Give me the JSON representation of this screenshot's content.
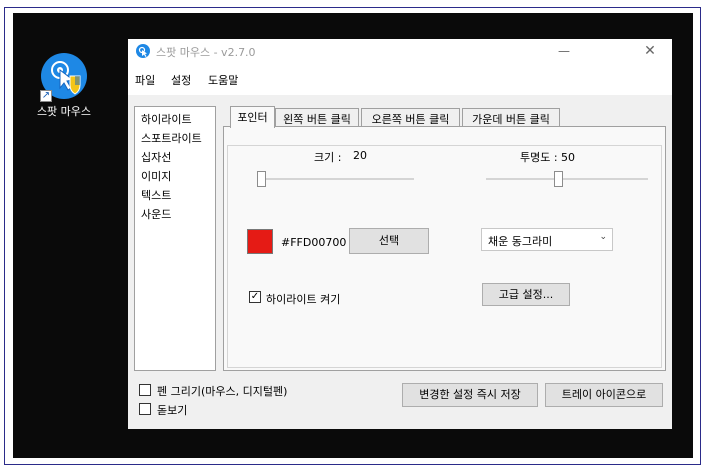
{
  "desktop_icon": {
    "label": "스팟 마우스",
    "icon": "spot-mouse-app-icon"
  },
  "window": {
    "title": "스팟 마우스 - v2.7.0",
    "minimize": "—",
    "close": "✕"
  },
  "menu": {
    "items": [
      "파일",
      "설정",
      "도움말"
    ]
  },
  "sidebar": {
    "items": [
      "하이라이트",
      "스포트라이트",
      "십자선",
      "이미지",
      "텍스트",
      "사운드"
    ]
  },
  "tabs": [
    "포인터",
    "왼쪽 버튼 클릭",
    "오른쪽 버튼 클릭",
    "가운데 버튼 클릭"
  ],
  "pointer": {
    "size_label": "크기 :",
    "size_value": "20",
    "opacity_label": "투명도 : 50",
    "size_slider_level": 0.05,
    "opacity_slider_level": 0.5,
    "color_hex": "#FFD00700",
    "swatch_color": "#e51b15",
    "select_button": "선택",
    "shape_select": "채운 동그라미",
    "shape_arrow": "⌄",
    "highlight_checkbox": "하이라이트 켜기",
    "highlight_checked": true,
    "check_mark": "✓",
    "advanced_button": "고급 설정..."
  },
  "bottom": {
    "pen_checkbox": "펜 그리기(마우스, 디지털펜)",
    "magnifier_checkbox": "돋보기",
    "save_button": "변경한 설정 즉시 저장",
    "tray_button": "트레이 아이콘으로"
  },
  "colors": {
    "accent": "#1e88e5",
    "desktop": "#0a0a0a",
    "swatch": "#e51b15"
  }
}
